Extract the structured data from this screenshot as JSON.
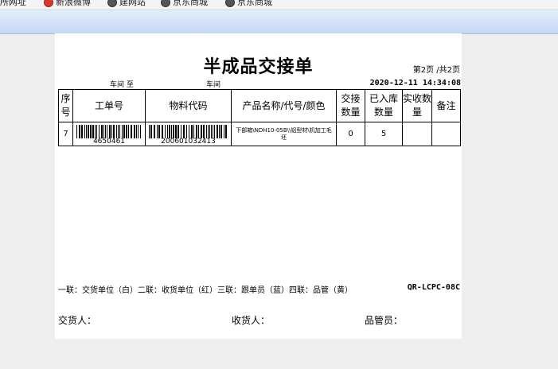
{
  "favorites": [
    {
      "label": "所网址",
      "icon": "ie-icon"
    },
    {
      "label": "新浪微博",
      "icon": "weibo-icon"
    },
    {
      "label": "建网站",
      "icon": "ie-icon"
    },
    {
      "label": "京东商城",
      "icon": "ie-icon"
    },
    {
      "label": "京东商城",
      "icon": "ie-icon"
    }
  ],
  "form": {
    "title": "半成品交接单",
    "page_info": "第2页 /共2页",
    "workshop_label": "车间 至",
    "workshop_to_label": "车间",
    "datetime": "2020-12-11 14:34:08",
    "columns": [
      "序号",
      "工单号",
      "物料代码",
      "产品名称/代号/颜色",
      "交接数量",
      "已入库数量",
      "实收数量",
      "备注"
    ],
    "rows": [
      {
        "seq": "7",
        "work_order": "4650461",
        "material_code": "200601032413",
        "product_name": "下部箱\\NDH10-05B\\\\铝型材\\机加工毛坯",
        "handover_qty": "0",
        "stored_qty": "5",
        "received_qty": "",
        "remark": ""
      }
    ],
    "footnote": "一联：交货单位（白）二联：收货单位（红）三联：跟单员（蓝）四联：品管（黄）",
    "doc_code": "QR-LCPC-08C",
    "signatures": {
      "deliverer": "交货人：",
      "receiver": "收货人：",
      "qc": "品管员："
    }
  }
}
